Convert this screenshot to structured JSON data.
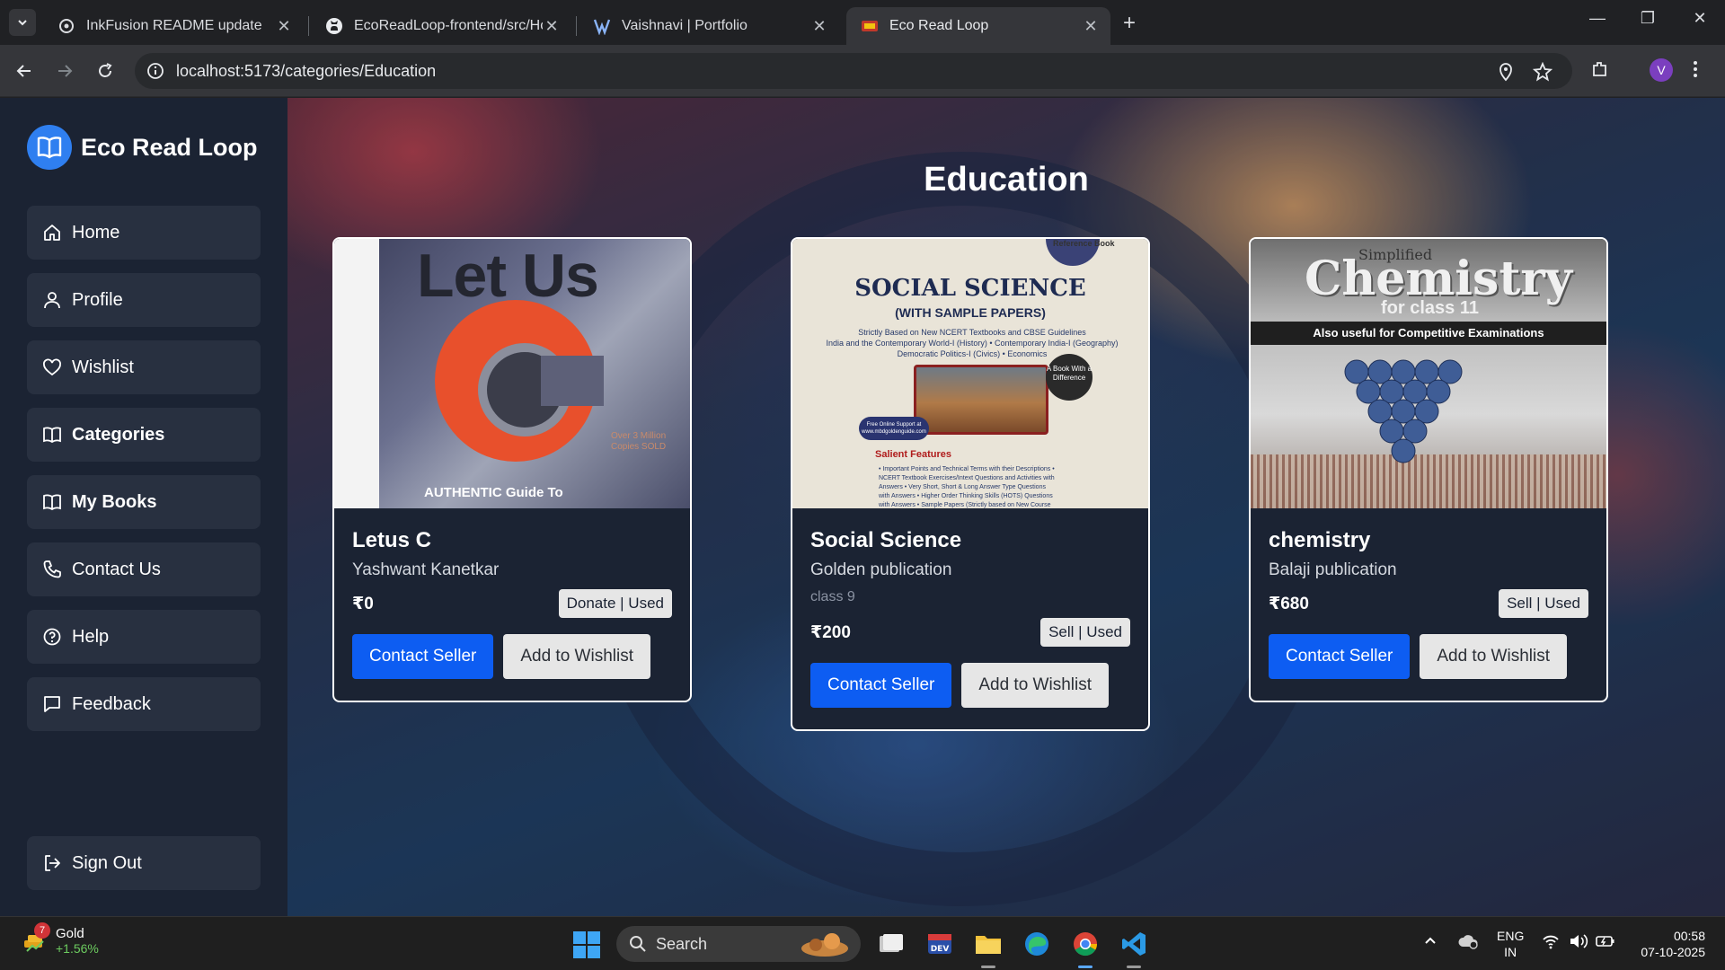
{
  "browser": {
    "tabs": [
      {
        "title": "InkFusion README update",
        "active": false
      },
      {
        "title": "EcoReadLoop-frontend/src/Hom",
        "active": false
      },
      {
        "title": "Vaishnavi | Portfolio",
        "active": false
      },
      {
        "title": "Eco Read Loop",
        "active": true
      }
    ],
    "url": "localhost:5173/categories/Education",
    "profile_initial": "V"
  },
  "sidebar": {
    "brand": "Eco Read Loop",
    "items": [
      {
        "label": "Home",
        "icon": "home-icon"
      },
      {
        "label": "Profile",
        "icon": "user-icon"
      },
      {
        "label": "Wishlist",
        "icon": "heart-icon"
      },
      {
        "label": "Categories",
        "icon": "book-open-icon",
        "active": true
      },
      {
        "label": "My Books",
        "icon": "book-open-icon"
      },
      {
        "label": "Contact Us",
        "icon": "phone-icon"
      },
      {
        "label": "Help",
        "icon": "help-circle-icon"
      },
      {
        "label": "Feedback",
        "icon": "message-square-icon"
      }
    ],
    "signout": "Sign Out"
  },
  "page": {
    "title": "Education",
    "books": [
      {
        "title": "Letus C",
        "author": "Yashwant Kanetkar",
        "description": "",
        "price": "₹0",
        "badge": "Donate | Used",
        "contact": "Contact Seller",
        "wishlist": "Add to Wishlist",
        "cover": {
          "line1": "Let Us",
          "line2": "AUTHENTIC Guide To",
          "line3": "Over 3 Million Copies SOLD"
        }
      },
      {
        "title": "Social Science",
        "author": "Golden publication",
        "description": "class 9",
        "price": "₹200",
        "badge": "Sell | Used",
        "contact": "Contact Seller",
        "wishlist": "Add to Wishlist",
        "cover": {
          "ref": "Reference Book",
          "line1": "SOCIAL SCIENCE",
          "line2": "(WITH SAMPLE PAPERS)",
          "line3": "Strictly Based on New NCERT Textbooks and CBSE Guidelines",
          "line4": "India and the Contemporary World-I (History) • Contemporary India-I (Geography) Democratic Politics-I (Civics) • Economics",
          "seal": "A Book With a Difference",
          "pill": "Free Online Support at www.mbdgoldenguide.com",
          "salient": "Salient Features",
          "features": "• Important Points and Technical Terms with their Descriptions • NCERT Textbook Exercises/Intext Questions and Activities with Answers • Very Short, Short & Long Answer Type Questions with Answers • Higher Order Thinking Skills (HOTS) Questions with Answers • Sample Papers (Strictly based on New Course Structure)"
        }
      },
      {
        "title": "chemistry",
        "author": "Balaji publication",
        "description": "",
        "price": "₹680",
        "badge": "Sell | Used",
        "contact": "Contact Seller",
        "wishlist": "Add to Wishlist",
        "cover": {
          "line1": "Simplified",
          "line2": "Chemistry",
          "line3": "for class 11",
          "line4": "Also useful for Competitive Examinations"
        }
      }
    ]
  },
  "taskbar": {
    "weather_name": "Gold",
    "weather_change": "+1.56%",
    "weather_badge": "7",
    "search": "Search",
    "lang1": "ENG",
    "lang2": "IN",
    "time": "00:58",
    "date": "07-10-2025"
  },
  "colors": {
    "sidebar_bg": "#1b2333",
    "nav_item_bg": "#283040",
    "brand_blue": "#2f7ff0",
    "primary_button": "#0d5df2",
    "secondary_button": "#e6e6e6"
  }
}
